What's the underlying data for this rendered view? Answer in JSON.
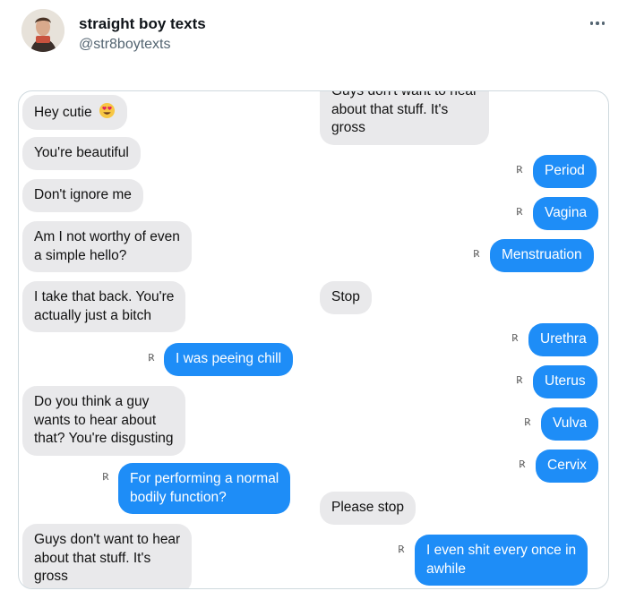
{
  "tweet": {
    "display_name": "straight boy texts",
    "handle": "@str8boytexts"
  },
  "icons": {
    "more": "more-horizontal-icon",
    "read_receipt": "read-receipt-icon",
    "emoji": "smiling-face-with-heart-eyes-emoji"
  },
  "colors": {
    "incoming_bubble": "#e9e9eb",
    "outgoing_bubble": "#1e8df7",
    "handle_text": "#536471",
    "card_border": "#cfd9de"
  },
  "receipt_glyph": "R̷",
  "left_column": {
    "messages": [
      {
        "side": "incoming",
        "text": "Hey cutie",
        "emoji": "😍"
      },
      {
        "side": "incoming",
        "text": "You're beautiful"
      },
      {
        "side": "incoming",
        "text": "Don't ignore me"
      },
      {
        "side": "incoming",
        "lines": [
          "Am I not worthy of even",
          "a simple hello?"
        ]
      },
      {
        "side": "incoming",
        "lines": [
          "I take that back. You're",
          "actually just a bitch"
        ]
      },
      {
        "side": "outgoing",
        "text": "I was peeing chill",
        "receipt": true
      },
      {
        "side": "incoming",
        "lines": [
          "Do you think a guy",
          "wants to hear about",
          "that? You're disgusting"
        ]
      },
      {
        "side": "outgoing",
        "lines": [
          "For performing a normal",
          "bodily function?"
        ],
        "receipt": true
      },
      {
        "side": "incoming",
        "lines": [
          "Guys don't want to hear",
          "about that stuff. It's",
          "gross"
        ]
      }
    ]
  },
  "right_column": {
    "messages": [
      {
        "side": "incoming",
        "lines": [
          "Guys don't want to hear",
          "about that stuff. It's",
          "gross"
        ]
      },
      {
        "side": "outgoing",
        "text": "Period",
        "receipt": true
      },
      {
        "side": "outgoing",
        "text": "Vagina",
        "receipt": true
      },
      {
        "side": "outgoing",
        "text": "Menstruation",
        "receipt": true
      },
      {
        "side": "incoming",
        "text": "Stop"
      },
      {
        "side": "outgoing",
        "text": "Urethra",
        "receipt": true
      },
      {
        "side": "outgoing",
        "text": "Uterus",
        "receipt": true
      },
      {
        "side": "outgoing",
        "text": "Vulva",
        "receipt": true
      },
      {
        "side": "outgoing",
        "text": "Cervix",
        "receipt": true
      },
      {
        "side": "incoming",
        "text": "Please stop"
      },
      {
        "side": "outgoing",
        "lines": [
          "I even shit every once in",
          "awhile"
        ],
        "receipt": true
      }
    ]
  }
}
